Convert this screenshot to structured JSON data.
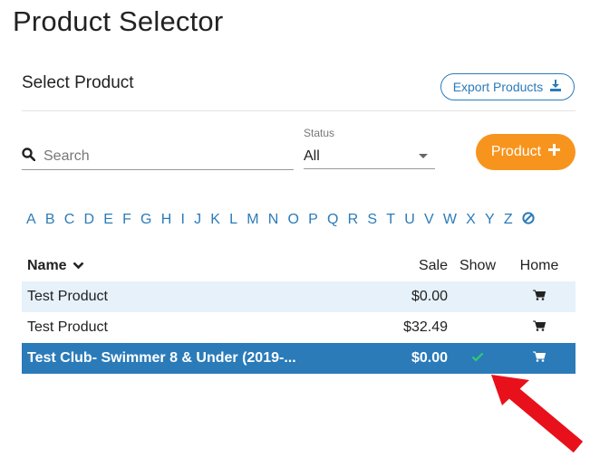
{
  "page": {
    "title": "Product Selector"
  },
  "section": {
    "title": "Select Product"
  },
  "toolbar": {
    "export_label": "Export Products",
    "product_label": "Product"
  },
  "search": {
    "placeholder": "Search",
    "value": ""
  },
  "status": {
    "label": "Status",
    "value": "All"
  },
  "alphabet": [
    "A",
    "B",
    "C",
    "D",
    "E",
    "F",
    "G",
    "H",
    "I",
    "J",
    "K",
    "L",
    "M",
    "N",
    "O",
    "P",
    "Q",
    "R",
    "S",
    "T",
    "U",
    "V",
    "W",
    "X",
    "Y",
    "Z"
  ],
  "table": {
    "headers": {
      "name": "Name",
      "sale": "Sale",
      "show": "Show",
      "home": "Home"
    },
    "rows": [
      {
        "name": "Test Product",
        "sale": "$0.00",
        "show": false,
        "home_icon": "cart-icon"
      },
      {
        "name": "Test Product",
        "sale": "$32.49",
        "show": false,
        "home_icon": "cart-icon"
      },
      {
        "name": "Test Club- Swimmer 8 & Under (2019-...",
        "sale": "$0.00",
        "show": true,
        "home_icon": "cart-icon",
        "selected": true
      }
    ]
  },
  "colors": {
    "accent": "#2b7bb9",
    "orange": "#f7941d",
    "row_highlight": "#e6f1fa",
    "check": "#2ecc71",
    "arrow": "#e8101b"
  }
}
